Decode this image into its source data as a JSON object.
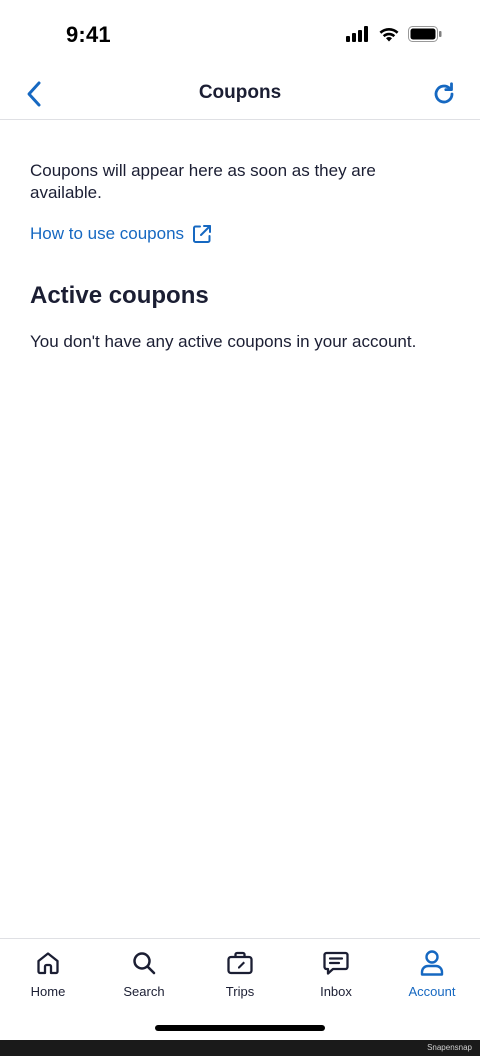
{
  "status_bar": {
    "time": "9:41"
  },
  "header": {
    "title": "Coupons"
  },
  "content": {
    "info_text": "Coupons will appear here as soon as they are available.",
    "howto_link": "How to use coupons",
    "section_heading": "Active coupons",
    "empty_text": "You don't have any active coupons in your account."
  },
  "tabs": [
    {
      "label": "Home",
      "icon": "home-icon"
    },
    {
      "label": "Search",
      "icon": "search-icon"
    },
    {
      "label": "Trips",
      "icon": "suitcase-icon"
    },
    {
      "label": "Inbox",
      "icon": "message-icon"
    },
    {
      "label": "Account",
      "icon": "person-icon",
      "active": true
    }
  ],
  "colors": {
    "accent": "#1668c1",
    "text": "#1b1e33",
    "divider": "#dfe0e4"
  },
  "watermark": "Snapensnap"
}
